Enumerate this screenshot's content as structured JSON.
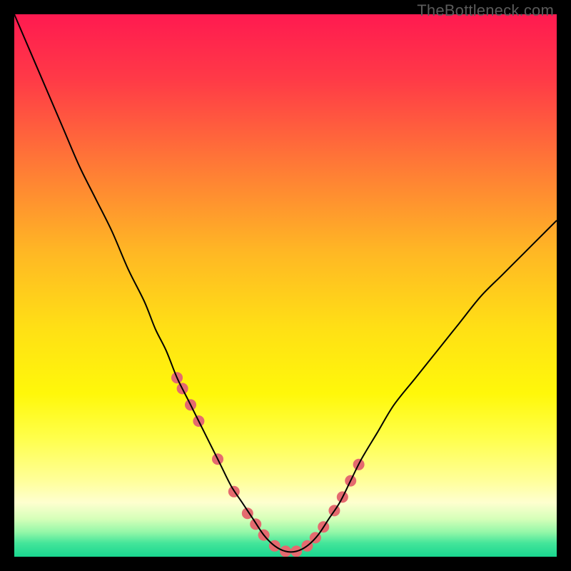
{
  "watermark": "TheBottleneck.com",
  "chart_data": {
    "type": "line",
    "title": "",
    "xlabel": "",
    "ylabel": "",
    "xlim": [
      0,
      100
    ],
    "ylim": [
      0,
      100
    ],
    "grid": false,
    "legend": false,
    "background_gradient": {
      "stops": [
        {
          "offset": 0.0,
          "color": "#ff1a50"
        },
        {
          "offset": 0.12,
          "color": "#ff3a47"
        },
        {
          "offset": 0.28,
          "color": "#ff7a36"
        },
        {
          "offset": 0.44,
          "color": "#ffb824"
        },
        {
          "offset": 0.58,
          "color": "#ffe015"
        },
        {
          "offset": 0.7,
          "color": "#fff80a"
        },
        {
          "offset": 0.78,
          "color": "#ffff4a"
        },
        {
          "offset": 0.86,
          "color": "#ffff9a"
        },
        {
          "offset": 0.9,
          "color": "#feffcf"
        },
        {
          "offset": 0.93,
          "color": "#d6ffb9"
        },
        {
          "offset": 0.955,
          "color": "#93f7a8"
        },
        {
          "offset": 0.975,
          "color": "#44e59a"
        },
        {
          "offset": 1.0,
          "color": "#19d68f"
        }
      ]
    },
    "series": [
      {
        "name": "bottleneck-curve",
        "stroke": "#000000",
        "stroke_width": 2,
        "x": [
          0,
          3,
          6,
          9,
          12,
          15,
          18,
          21,
          24,
          26,
          28,
          30,
          32,
          34,
          36,
          38,
          40,
          42,
          44,
          46,
          48,
          50,
          52,
          54,
          56,
          58,
          60,
          62,
          64,
          67,
          70,
          74,
          78,
          82,
          86,
          90,
          94,
          98,
          100
        ],
        "values": [
          100,
          93,
          86,
          79,
          72,
          66,
          60,
          53,
          47,
          42,
          38,
          33,
          29,
          25,
          21,
          17,
          13,
          10,
          7,
          4,
          2,
          1,
          1,
          2,
          4,
          7,
          10,
          14,
          18,
          23,
          28,
          33,
          38,
          43,
          48,
          52,
          56,
          60,
          62
        ]
      }
    ],
    "markers": {
      "name": "highlight-dots",
      "fill": "#e46a6f",
      "radius": 8,
      "x": [
        30.0,
        31.0,
        32.5,
        34.0,
        37.5,
        40.5,
        43.0,
        44.5,
        46.0,
        48.0,
        50.0,
        52.0,
        54.0,
        55.5,
        57.0,
        59.0,
        60.5,
        62.0,
        63.5
      ],
      "values": [
        33.0,
        31.0,
        28.0,
        25.0,
        18.0,
        12.0,
        8.0,
        6.0,
        4.0,
        2.0,
        1.0,
        1.0,
        2.0,
        3.5,
        5.5,
        8.5,
        11.0,
        14.0,
        17.0
      ]
    }
  }
}
